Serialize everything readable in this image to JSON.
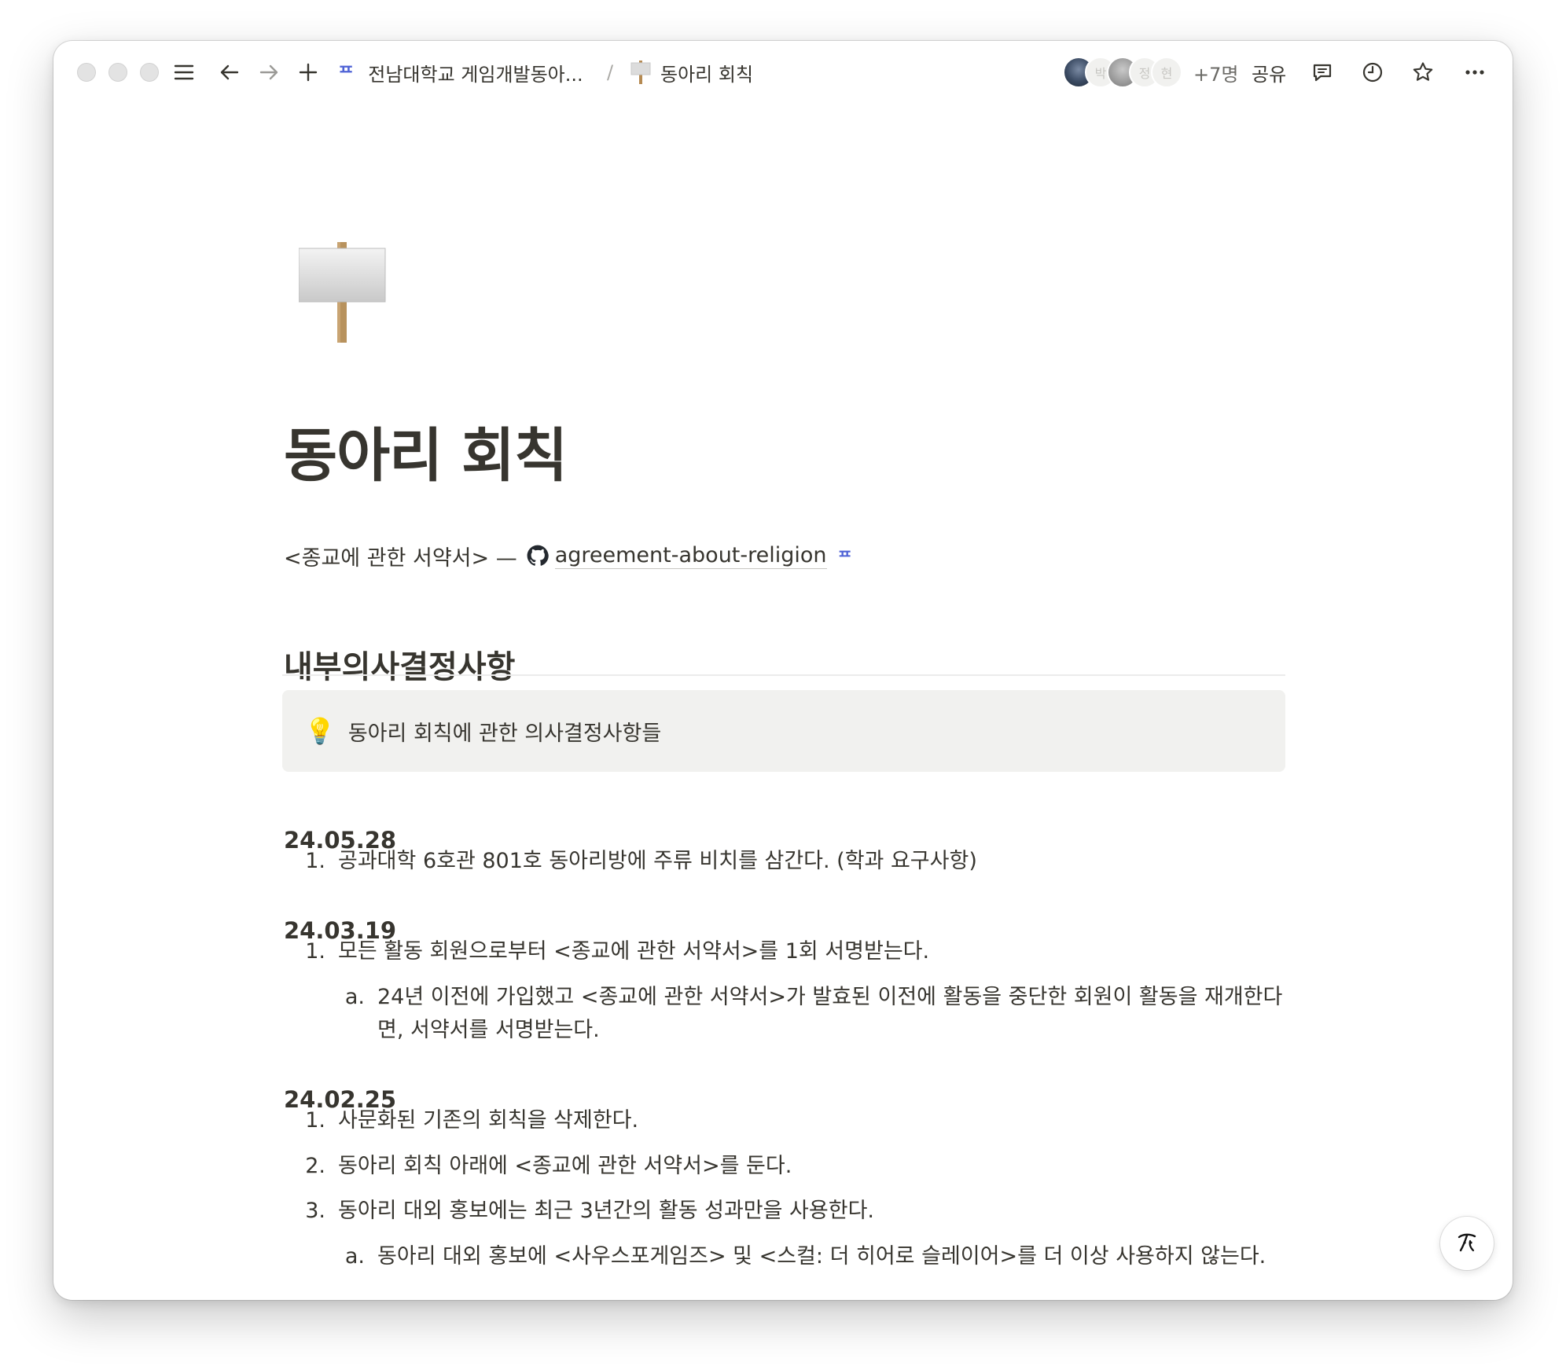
{
  "breadcrumb": {
    "workspace_logo": "ᄑ",
    "workspace": "전남대학교 게임개발동아...",
    "separator": "/",
    "page": "동아리 회칙"
  },
  "topbar": {
    "avatar_labels": [
      "박",
      "정",
      "현"
    ],
    "more_count": "+7명",
    "share_label": "공유"
  },
  "page": {
    "title": "동아리 회칙",
    "agreement": {
      "prefix": "<종교에 관한 서약서> —",
      "link_text": "agreement-about-religion",
      "source_logo": "ᄑ"
    },
    "heading": "내부의사결정사항",
    "callout": {
      "icon": "💡",
      "text": "동아리 회칙에 관한 의사결정사항들"
    },
    "sections": [
      {
        "date": "24.05.28",
        "items": [
          {
            "num": "1.",
            "text": "공과대학 6호관 801호 동아리방에 주류 비치를 삼간다. (학과 요구사항)"
          }
        ]
      },
      {
        "date": "24.03.19",
        "items": [
          {
            "num": "1.",
            "text": "모든 활동 회원으로부터 <종교에 관한 서약서>를 1회 서명받는다."
          },
          {
            "num": "a.",
            "text": "24년 이전에 가입했고 <종교에 관한 서약서>가 발효된 이전에 활동을 중단한 회원이 활동을 재개한다면, 서약서를 서명받는다."
          }
        ]
      },
      {
        "date": "24.02.25",
        "items": [
          {
            "num": "1.",
            "text": "사문화된 기존의 회칙을 삭제한다."
          },
          {
            "num": "2.",
            "text": "동아리 회칙 아래에 <종교에 관한 서약서>를 둔다."
          },
          {
            "num": "3.",
            "text": "동아리 대외 홍보에는 최근 3년간의 활동 성과만을 사용한다."
          },
          {
            "num": "a.",
            "text": "동아리 대외 홍보에 <사우스포게임즈> 및 <스컬: 더 히어로 슬레이어>를 더 이상 사용하지 않는다."
          }
        ]
      }
    ]
  }
}
